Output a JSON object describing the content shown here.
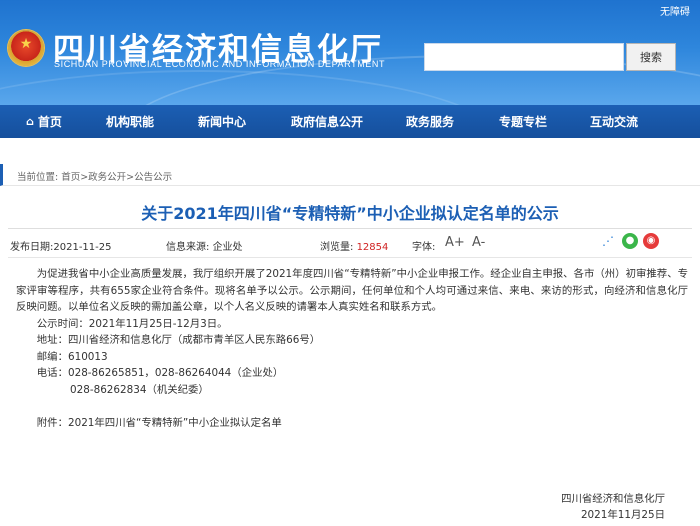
{
  "header": {
    "accessibility": "无障碍",
    "site_title": "四川省经济和信息化厅",
    "site_subtitle": "SICHUAN PROVINCIAL ECONOMIC AND INFORMATION DEPARTMENT",
    "search_placeholder": "",
    "search_button": "搜索"
  },
  "nav": {
    "items": [
      "首页",
      "机构职能",
      "新闻中心",
      "政府信息公开",
      "政务服务",
      "专题专栏",
      "互动交流"
    ]
  },
  "breadcrumb": "当前位置: 首页>政务公开>公告公示",
  "article": {
    "title": "关于2021年四川省“专精特新”中小企业拟认定名单的公示",
    "publish_date_label": "发布日期:",
    "publish_date": "2021-11-25",
    "source_label": "信息来源:",
    "source": "企业处",
    "views_label": "浏览量:",
    "views": "12854",
    "font_label": "字体:",
    "font_increase": "A+",
    "font_decrease": "A-",
    "paragraph1": "为促进我省中小企业高质量发展，我厅组织开展了2021年度四川省“专精特新”中小企业申报工作。经企业自主申报、各市（州）初审推荐、专家评审等程序，共有655家企业符合条件。现将名单予以公示。公示期间，任何单位和个人均可通过来信、来电、来访的形式，向经济和信息化厅反映问题。以单位名义反映的需加盖公章，以个人名义反映的请署本人真实姓名和联系方式。",
    "period": "公示时间：2021年11月25日-12月3日。",
    "address": "地址：四川省经济和信息化厅（成都市青羊区人民东路66号）",
    "postcode": "邮编：610013",
    "phone1": "电话：028-86265851，028-86264044（企业处）",
    "phone2": "028-86262834（机关纪委）",
    "attachment": "附件：2021年四川省“专精特新”中小企业拟认定名单",
    "sign_org": "四川省经济和信息化厅",
    "sign_date": "2021年11月25日"
  },
  "colors": {
    "brand_blue": "#1c5fb4",
    "title_blue": "#1c5fb4",
    "views_red": "#d02323"
  }
}
